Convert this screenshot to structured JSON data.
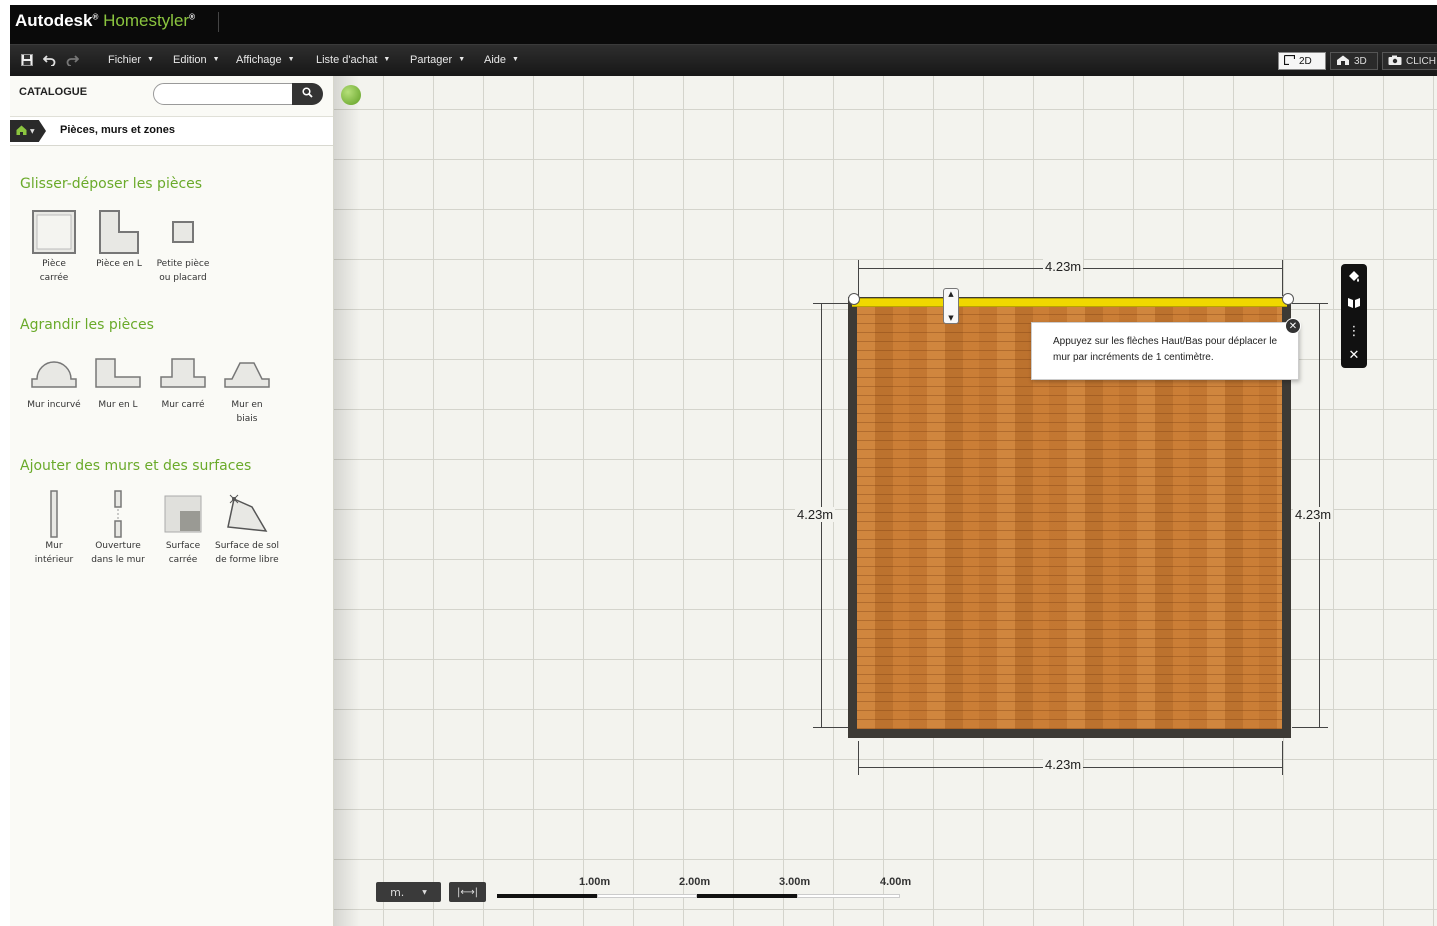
{
  "app": {
    "brand_autodesk": "Autodesk",
    "brand_homestyler": "Homestyler",
    "reg_mark": "®"
  },
  "menu": {
    "items": [
      "Fichier",
      "Edition",
      "Affichage",
      "Liste d'achat",
      "Partager",
      "Aide"
    ],
    "view_2d": "2D",
    "view_3d": "3D",
    "view_cli": "CLICH"
  },
  "sidebar": {
    "catalogue_label": "CATALOGUE",
    "search_placeholder": "",
    "breadcrumb": "Pièces, murs et zones",
    "sections": [
      {
        "title": "Glisser-déposer les pièces",
        "items": [
          {
            "label1": "Pièce",
            "label2": "carrée"
          },
          {
            "label1": "Pièce en L",
            "label2": ""
          },
          {
            "label1": "Petite pièce",
            "label2": "ou placard"
          }
        ]
      },
      {
        "title": "Agrandir les pièces",
        "items": [
          {
            "label1": "Mur incurvé",
            "label2": ""
          },
          {
            "label1": "Mur en L",
            "label2": ""
          },
          {
            "label1": "Mur carré",
            "label2": ""
          },
          {
            "label1": "Mur en",
            "label2": "biais"
          }
        ]
      },
      {
        "title": "Ajouter des murs et des surfaces",
        "items": [
          {
            "label1": "Mur",
            "label2": "intérieur"
          },
          {
            "label1": "Ouverture",
            "label2": "dans le mur"
          },
          {
            "label1": "Surface",
            "label2": "carrée"
          },
          {
            "label1": "Surface de sol",
            "label2": "de forme libre"
          }
        ]
      }
    ]
  },
  "canvas": {
    "dim_top": "4.23m",
    "dim_bottom": "4.23m",
    "dim_left": "4.23m",
    "dim_right": "4.23m",
    "tooltip_line1": "Appuyez sur les flèches Haut/Bas pour déplacer le",
    "tooltip_line2": "mur par incréments de 1 centimètre.",
    "unit": "m.",
    "scale_labels": [
      "1.00m",
      "2.00m",
      "3.00m",
      "4.00m"
    ]
  },
  "colors": {
    "accent_green": "#6aaa2a",
    "selected_wall": "#f0d800",
    "floor_wood": "#c97d35"
  }
}
